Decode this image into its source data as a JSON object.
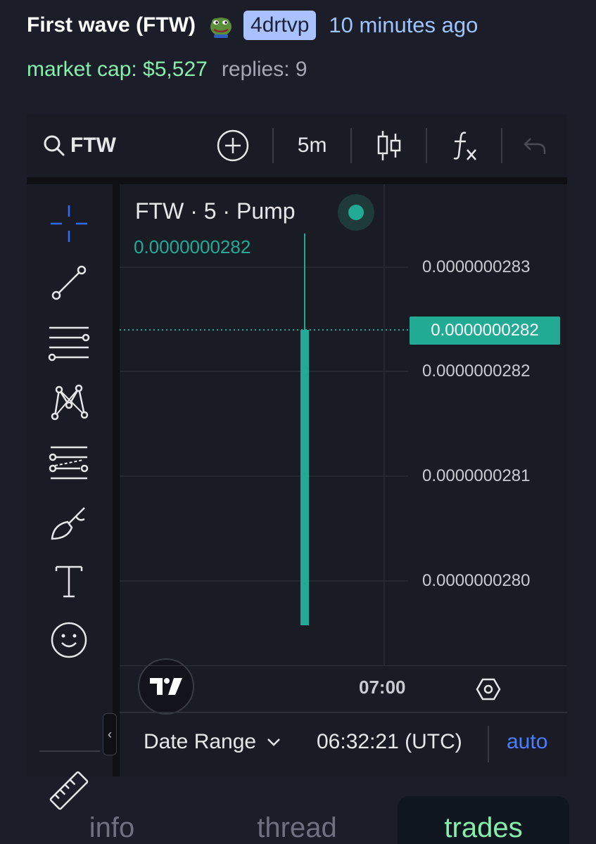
{
  "header": {
    "title": "First wave (FTW)",
    "creator": "4drtvp",
    "time_ago": "10 minutes ago"
  },
  "stats": {
    "market_cap": "market cap: $5,527",
    "replies": "replies: 9"
  },
  "chart": {
    "toolbar": {
      "symbol": "FTW",
      "interval": "5m"
    },
    "legend": "FTW · 5 · Pump",
    "legend_price": "0.0000000282",
    "yaxis_labels": [
      "0.0000000283",
      "0.0000000282",
      "0.0000000281",
      "0.0000000280"
    ],
    "current_price_label": "0.0000000282",
    "xaxis_label": "07:00",
    "date_range": "Date Range",
    "clock": "06:32:21 (UTC)",
    "auto": "auto",
    "accent_color": "#22ab94"
  },
  "tabs": [
    {
      "label": "info",
      "active": false
    },
    {
      "label": "thread",
      "active": false
    },
    {
      "label": "trades",
      "active": true
    }
  ]
}
